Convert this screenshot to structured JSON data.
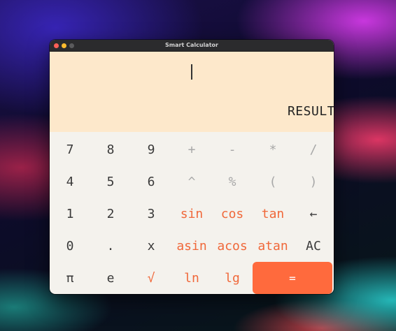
{
  "window": {
    "title": "Smart Calculator"
  },
  "display": {
    "input_value": "",
    "result": "RESULT"
  },
  "colors": {
    "display_bg": "#fde8cb",
    "keypad_bg": "#f4f2ed",
    "accent": "#ff6a3d",
    "function_text": "#f0683a",
    "operator_text": "#a8a8a8"
  },
  "keys": {
    "seven": "7",
    "eight": "8",
    "nine": "9",
    "plus": "+",
    "minus": "-",
    "multiply": "*",
    "divide": "/",
    "four": "4",
    "five": "5",
    "six": "6",
    "power": "^",
    "percent": "%",
    "lparen": "(",
    "rparen": ")",
    "one": "1",
    "two": "2",
    "three": "3",
    "sin": "sin",
    "cos": "cos",
    "tan": "tan",
    "backspace": "←",
    "zero": "0",
    "dot": ".",
    "x": "x",
    "asin": "asin",
    "acos": "acos",
    "atan": "atan",
    "clear": "AC",
    "pi": "π",
    "e": "e",
    "sqrt": "√",
    "ln": "ln",
    "lg": "lg",
    "equals": "="
  }
}
